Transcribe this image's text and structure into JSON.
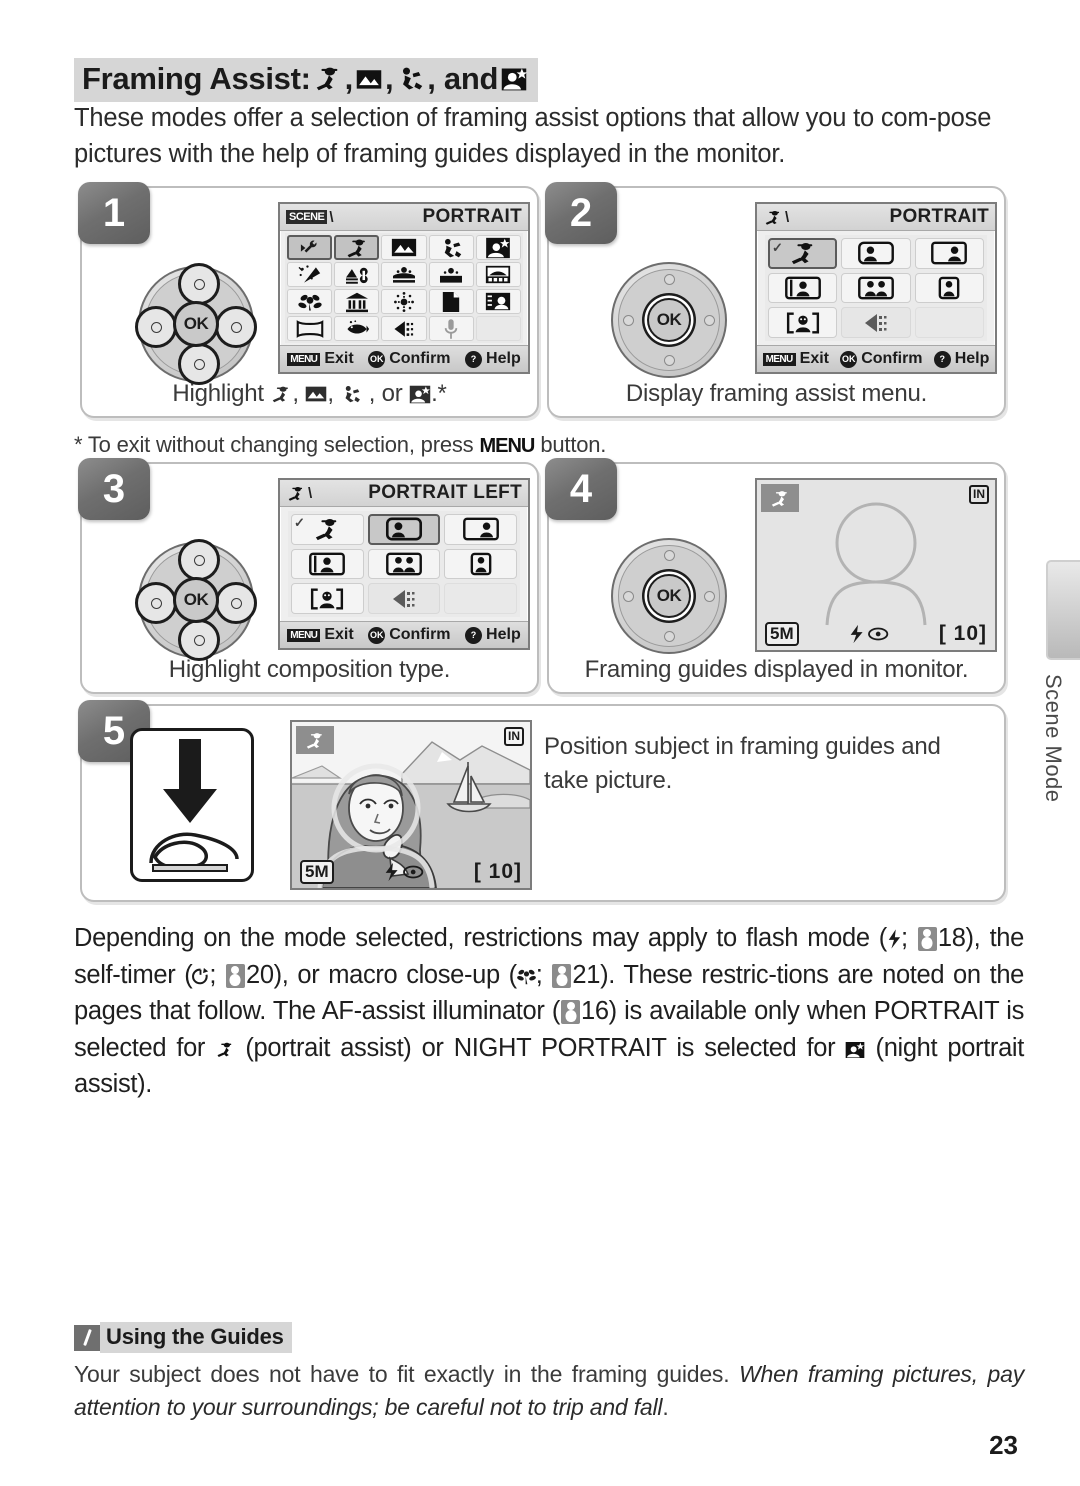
{
  "header": {
    "title_prefix": "Framing Assist:",
    "title_icons": [
      "portrait-assist-icon",
      "landscape-assist-icon",
      "sport-assist-icon",
      "night-portrait-assist-icon"
    ],
    "title_sep1": ",",
    "title_sep2": ",",
    "title_and": ", and"
  },
  "intro": "These modes offer a selection of framing assist options that allow you to com-pose pictures with the help of framing guides displayed in the monitor.",
  "footnote": {
    "prefix": "* To exit without changing selection, press",
    "key": "MENU",
    "suffix": "button."
  },
  "steps": [
    {
      "number": "1",
      "caption_prefix": "Highlight",
      "caption_sep": ",",
      "caption_or": ", or",
      "caption_suffix": ".*",
      "lcd": {
        "mode_tag": "SCENE",
        "title": "PORTRAIT",
        "selected_index": 1,
        "icons": [
          "setup-wrench-icon",
          "portrait-assist-icon",
          "landscape-assist-icon",
          "sport-assist-icon",
          "night-portrait-assist-icon",
          "party-indoor-icon",
          "night-landscape-icon",
          "beach-snow-icon",
          "sunset-icon",
          "dusk-dawn-icon",
          "close-up-icon",
          "museum-icon",
          "fireworks-icon",
          "copy-icon",
          "back-light-icon",
          "panorama-assist-icon",
          "underwater-icon",
          "color-options-icon",
          "voice-recording-icon",
          "empty-cell"
        ],
        "bottom": [
          {
            "key": "MENU",
            "label": "Exit",
            "key_type": "badge"
          },
          {
            "key": "OK",
            "label": "Confirm",
            "key_type": "round"
          },
          {
            "key": "?",
            "label": "Help",
            "key_type": "round"
          }
        ]
      }
    },
    {
      "number": "2",
      "caption": "Display framing assist menu.",
      "lcd": {
        "mode_icon": "portrait-assist-icon",
        "title": "PORTRAIT",
        "selected_index": 0,
        "check_index": 0,
        "icons": [
          "portrait-assist-icon",
          "portrait-left-icon",
          "portrait-right-icon",
          "portrait-close-up-icon",
          "portrait-couple-icon",
          "portrait-figure-icon",
          "portrait-face-icon",
          "color-options-icon",
          "empty-cell"
        ],
        "dim_index": 7,
        "empty_index": 8,
        "bottom": [
          {
            "key": "MENU",
            "label": "Exit",
            "key_type": "badge"
          },
          {
            "key": "OK",
            "label": "Confirm",
            "key_type": "round"
          },
          {
            "key": "?",
            "label": "Help",
            "key_type": "round"
          }
        ]
      }
    },
    {
      "number": "3",
      "caption": "Highlight composition type.",
      "lcd": {
        "mode_icon": "portrait-assist-icon",
        "title": "PORTRAIT LEFT",
        "selected_index": 1,
        "check_index": 0,
        "icons": [
          "portrait-assist-icon",
          "portrait-left-icon",
          "portrait-right-icon",
          "portrait-close-up-icon",
          "portrait-couple-icon",
          "portrait-figure-icon",
          "portrait-face-icon",
          "color-options-icon",
          "empty-cell"
        ],
        "dim_index": 7,
        "empty_index": 8,
        "bottom": [
          {
            "key": "MENU",
            "label": "Exit",
            "key_type": "badge"
          },
          {
            "key": "OK",
            "label": "Confirm",
            "key_type": "round"
          },
          {
            "key": "?",
            "label": "Help",
            "key_type": "round"
          }
        ]
      }
    },
    {
      "number": "4",
      "caption": "Framing guides displayed in monitor.",
      "monitor": {
        "mode_icon": "portrait-assist-icon",
        "memory": "IN",
        "image_size": "5M",
        "flash_icon": "flash-red-eye-icon",
        "shots_remaining": "[ 10]"
      }
    },
    {
      "number": "5",
      "caption_line1": "Position subject in framing guides and",
      "caption_line2": "take picture.",
      "press_icon": "shutter-press-down-icon",
      "monitor": {
        "mode_icon": "portrait-assist-icon",
        "memory": "IN",
        "image_size": "5M",
        "flash_icon": "flash-red-eye-icon",
        "shots_remaining": "[ 10]"
      }
    }
  ],
  "side_tab": {
    "label": "Scene Mode"
  },
  "body_paragraph": {
    "p1": "Depending on the mode selected, restrictions may apply to flash mode (",
    "p2": "18), the self-timer (",
    "p3": "20), or macro close-up (",
    "p4": "21).  These restric-tions are noted on the pages that follow.  The AF-assist illuminator (",
    "p5": "16) is available only when PORTRAIT is selected for",
    "p6": "(portrait assist) or NIGHT PORTRAIT is selected for",
    "p7": "(night portrait assist).",
    "ref_18": "18",
    "ref_20": "20",
    "ref_21": "21",
    "ref_16": "16"
  },
  "note": {
    "icon": "pencil-icon",
    "title": "Using the Guides",
    "text_plain": "Your subject does not have to fit exactly in the framing guides. ",
    "text_italic": "When framing pictures, pay attention to your surroundings; be careful not to trip and fall",
    "text_end": "."
  },
  "page_number": "23"
}
